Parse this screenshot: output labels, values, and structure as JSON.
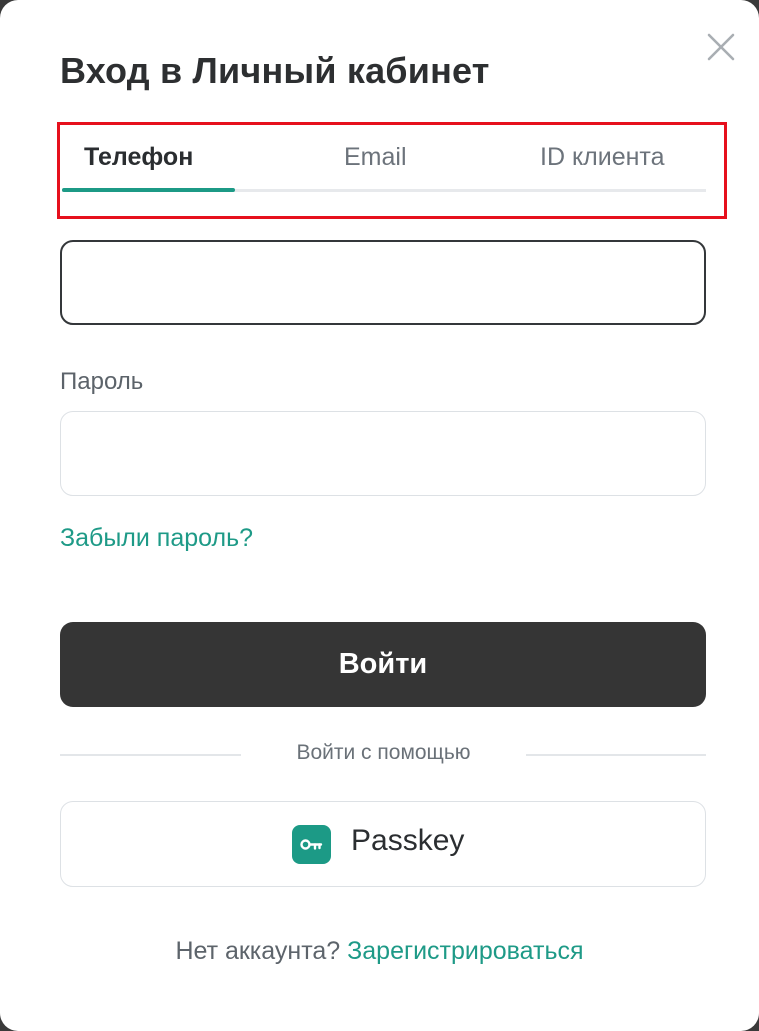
{
  "modal": {
    "title": "Вход в Личный кабинет",
    "close_icon": "close-icon"
  },
  "tabs": [
    {
      "label": "Телефон",
      "active": true
    },
    {
      "label": "Email",
      "active": false
    },
    {
      "label": "ID клиента",
      "active": false
    }
  ],
  "phone_input": {
    "value": "",
    "placeholder": ""
  },
  "password": {
    "label": "Пароль",
    "value": "",
    "placeholder": ""
  },
  "forgot_password": "Забыли пароль?",
  "login_button": "Войти",
  "divider_text": "Войти с помощью",
  "passkey": {
    "label": "Passkey",
    "icon": "key-icon"
  },
  "footer": {
    "no_account": "Нет аккаунта?",
    "register": "Зарегистрироваться"
  },
  "colors": {
    "accent": "#1c9a86",
    "primary_button": "#353535",
    "highlight_box": "#e6101d",
    "title_text": "#2d2f31"
  }
}
